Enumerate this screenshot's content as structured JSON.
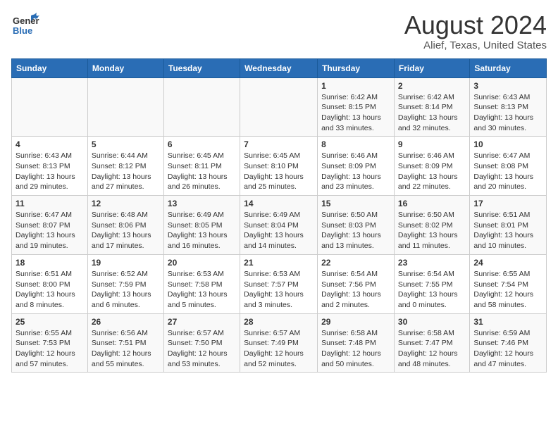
{
  "header": {
    "logo_line1": "General",
    "logo_line2": "Blue",
    "month_year": "August 2024",
    "location": "Alief, Texas, United States"
  },
  "weekdays": [
    "Sunday",
    "Monday",
    "Tuesday",
    "Wednesday",
    "Thursday",
    "Friday",
    "Saturday"
  ],
  "weeks": [
    [
      {
        "day": "",
        "info": ""
      },
      {
        "day": "",
        "info": ""
      },
      {
        "day": "",
        "info": ""
      },
      {
        "day": "",
        "info": ""
      },
      {
        "day": "1",
        "info": "Sunrise: 6:42 AM\nSunset: 8:15 PM\nDaylight: 13 hours\nand 33 minutes."
      },
      {
        "day": "2",
        "info": "Sunrise: 6:42 AM\nSunset: 8:14 PM\nDaylight: 13 hours\nand 32 minutes."
      },
      {
        "day": "3",
        "info": "Sunrise: 6:43 AM\nSunset: 8:13 PM\nDaylight: 13 hours\nand 30 minutes."
      }
    ],
    [
      {
        "day": "4",
        "info": "Sunrise: 6:43 AM\nSunset: 8:13 PM\nDaylight: 13 hours\nand 29 minutes."
      },
      {
        "day": "5",
        "info": "Sunrise: 6:44 AM\nSunset: 8:12 PM\nDaylight: 13 hours\nand 27 minutes."
      },
      {
        "day": "6",
        "info": "Sunrise: 6:45 AM\nSunset: 8:11 PM\nDaylight: 13 hours\nand 26 minutes."
      },
      {
        "day": "7",
        "info": "Sunrise: 6:45 AM\nSunset: 8:10 PM\nDaylight: 13 hours\nand 25 minutes."
      },
      {
        "day": "8",
        "info": "Sunrise: 6:46 AM\nSunset: 8:09 PM\nDaylight: 13 hours\nand 23 minutes."
      },
      {
        "day": "9",
        "info": "Sunrise: 6:46 AM\nSunset: 8:09 PM\nDaylight: 13 hours\nand 22 minutes."
      },
      {
        "day": "10",
        "info": "Sunrise: 6:47 AM\nSunset: 8:08 PM\nDaylight: 13 hours\nand 20 minutes."
      }
    ],
    [
      {
        "day": "11",
        "info": "Sunrise: 6:47 AM\nSunset: 8:07 PM\nDaylight: 13 hours\nand 19 minutes."
      },
      {
        "day": "12",
        "info": "Sunrise: 6:48 AM\nSunset: 8:06 PM\nDaylight: 13 hours\nand 17 minutes."
      },
      {
        "day": "13",
        "info": "Sunrise: 6:49 AM\nSunset: 8:05 PM\nDaylight: 13 hours\nand 16 minutes."
      },
      {
        "day": "14",
        "info": "Sunrise: 6:49 AM\nSunset: 8:04 PM\nDaylight: 13 hours\nand 14 minutes."
      },
      {
        "day": "15",
        "info": "Sunrise: 6:50 AM\nSunset: 8:03 PM\nDaylight: 13 hours\nand 13 minutes."
      },
      {
        "day": "16",
        "info": "Sunrise: 6:50 AM\nSunset: 8:02 PM\nDaylight: 13 hours\nand 11 minutes."
      },
      {
        "day": "17",
        "info": "Sunrise: 6:51 AM\nSunset: 8:01 PM\nDaylight: 13 hours\nand 10 minutes."
      }
    ],
    [
      {
        "day": "18",
        "info": "Sunrise: 6:51 AM\nSunset: 8:00 PM\nDaylight: 13 hours\nand 8 minutes."
      },
      {
        "day": "19",
        "info": "Sunrise: 6:52 AM\nSunset: 7:59 PM\nDaylight: 13 hours\nand 6 minutes."
      },
      {
        "day": "20",
        "info": "Sunrise: 6:53 AM\nSunset: 7:58 PM\nDaylight: 13 hours\nand 5 minutes."
      },
      {
        "day": "21",
        "info": "Sunrise: 6:53 AM\nSunset: 7:57 PM\nDaylight: 13 hours\nand 3 minutes."
      },
      {
        "day": "22",
        "info": "Sunrise: 6:54 AM\nSunset: 7:56 PM\nDaylight: 13 hours\nand 2 minutes."
      },
      {
        "day": "23",
        "info": "Sunrise: 6:54 AM\nSunset: 7:55 PM\nDaylight: 13 hours\nand 0 minutes."
      },
      {
        "day": "24",
        "info": "Sunrise: 6:55 AM\nSunset: 7:54 PM\nDaylight: 12 hours\nand 58 minutes."
      }
    ],
    [
      {
        "day": "25",
        "info": "Sunrise: 6:55 AM\nSunset: 7:53 PM\nDaylight: 12 hours\nand 57 minutes."
      },
      {
        "day": "26",
        "info": "Sunrise: 6:56 AM\nSunset: 7:51 PM\nDaylight: 12 hours\nand 55 minutes."
      },
      {
        "day": "27",
        "info": "Sunrise: 6:57 AM\nSunset: 7:50 PM\nDaylight: 12 hours\nand 53 minutes."
      },
      {
        "day": "28",
        "info": "Sunrise: 6:57 AM\nSunset: 7:49 PM\nDaylight: 12 hours\nand 52 minutes."
      },
      {
        "day": "29",
        "info": "Sunrise: 6:58 AM\nSunset: 7:48 PM\nDaylight: 12 hours\nand 50 minutes."
      },
      {
        "day": "30",
        "info": "Sunrise: 6:58 AM\nSunset: 7:47 PM\nDaylight: 12 hours\nand 48 minutes."
      },
      {
        "day": "31",
        "info": "Sunrise: 6:59 AM\nSunset: 7:46 PM\nDaylight: 12 hours\nand 47 minutes."
      }
    ]
  ]
}
